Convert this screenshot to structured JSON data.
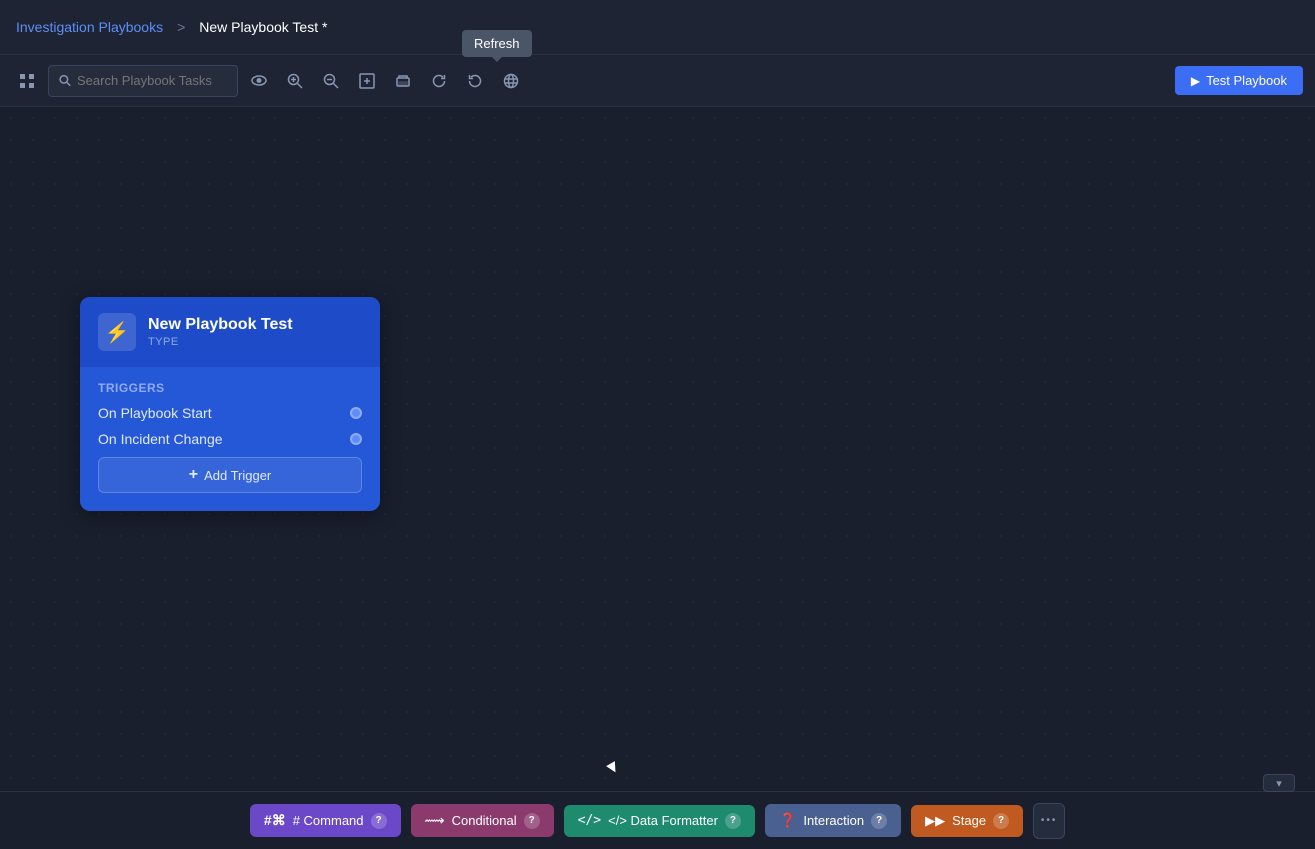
{
  "topnav": {
    "breadcrumb_link": "Investigation Playbooks",
    "breadcrumb_sep": ">",
    "breadcrumb_current": "New Playbook Test *"
  },
  "tooltip": {
    "label": "Refresh"
  },
  "toolbar": {
    "search_placeholder": "Search Playbook Tasks",
    "test_playbook_label": "Test Playbook"
  },
  "node": {
    "title": "New Playbook Test",
    "type_label": "TYPE",
    "triggers_heading": "Triggers",
    "trigger_1": "On Playbook Start",
    "trigger_2": "On Incident Change",
    "add_trigger_label": "Add Trigger"
  },
  "bottom_bar": {
    "collapse_icon": "▾",
    "btn_command": "# Command",
    "btn_conditional": "Conditional",
    "btn_dataformatter": "</> Data Formatter",
    "btn_interaction": "Interaction",
    "btn_stage": "Stage",
    "more_icon": "•••"
  },
  "icons": {
    "search": "🔍",
    "eye": "👁",
    "zoom_in": "⊕",
    "zoom_out": "⊖",
    "fit": "⊡",
    "print": "🖨",
    "refresh": "↺",
    "undo": "↩",
    "globe": "🌐",
    "play": "▶",
    "bolt": "⚡",
    "plus": "+"
  }
}
